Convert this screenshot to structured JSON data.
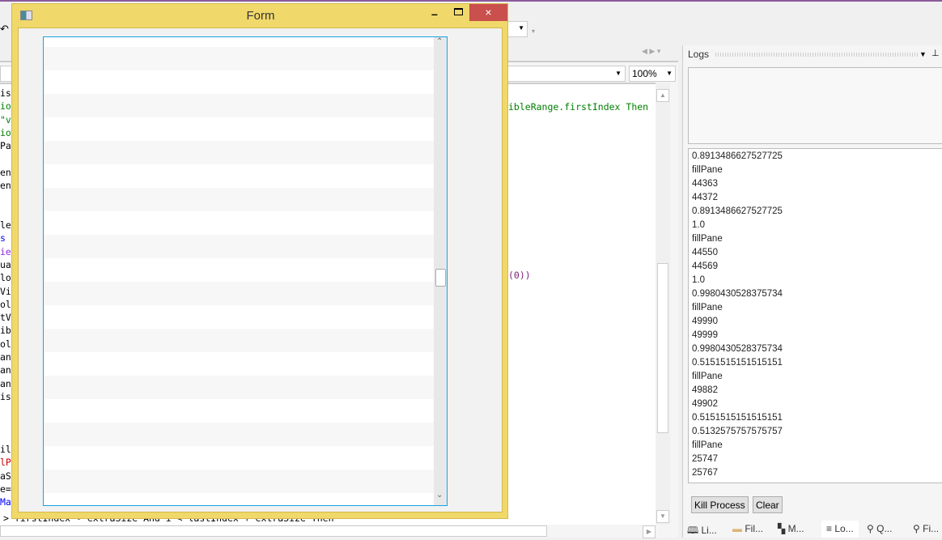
{
  "form": {
    "title": "Form",
    "row_count": 20,
    "close_label": "×"
  },
  "editor": {
    "zoom": "100%",
    "code_lines": [
      "isi",
      "io",
      "\"vi",
      "io",
      "Par",
      "",
      "ent",
      "ent",
      "",
      "",
      "leM",
      "s ",
      "ie",
      "ua",
      "lo",
      "Vi",
      "ol",
      "tV",
      "ib",
      "ol",
      "ang",
      "ang",
      "ang",
      "is",
      "",
      "",
      "",
      "il",
      "lP",
      "aS",
      "e=",
      "Ma"
    ],
    "code_right_1": "ibleRange.firstIndex Then",
    "code_right_2": "(0))",
    "code_bottom": "> firstIndex - extraSize And i < lastIndex + extraSize Then"
  },
  "logs": {
    "title": "Logs",
    "entries": [
      "0.8913486627527725",
      "fillPane",
      "44363",
      "44372",
      "0.8913486627527725",
      "1.0",
      "fillPane",
      "44550",
      "44569",
      "1.0",
      "0.9980430528375734",
      "fillPane",
      "49990",
      "49999",
      "0.9980430528375734",
      "0.5151515151515151",
      "fillPane",
      "49882",
      "49902",
      "0.5151515151515151",
      "0.5132575757575757",
      "fillPane",
      "25747",
      "25767"
    ],
    "kill_label": "Kill Process",
    "clear_label": "Clear"
  },
  "bottom_tabs": [
    {
      "label": "Li...",
      "icon": "book-icon"
    },
    {
      "label": "Fil...",
      "icon": "folder-icon"
    },
    {
      "label": "M...",
      "icon": "grid-icon"
    },
    {
      "label": "Lo...",
      "icon": "lines-icon"
    },
    {
      "label": "Q...",
      "icon": "search-icon"
    },
    {
      "label": "Fi...",
      "icon": "find-icon"
    }
  ]
}
